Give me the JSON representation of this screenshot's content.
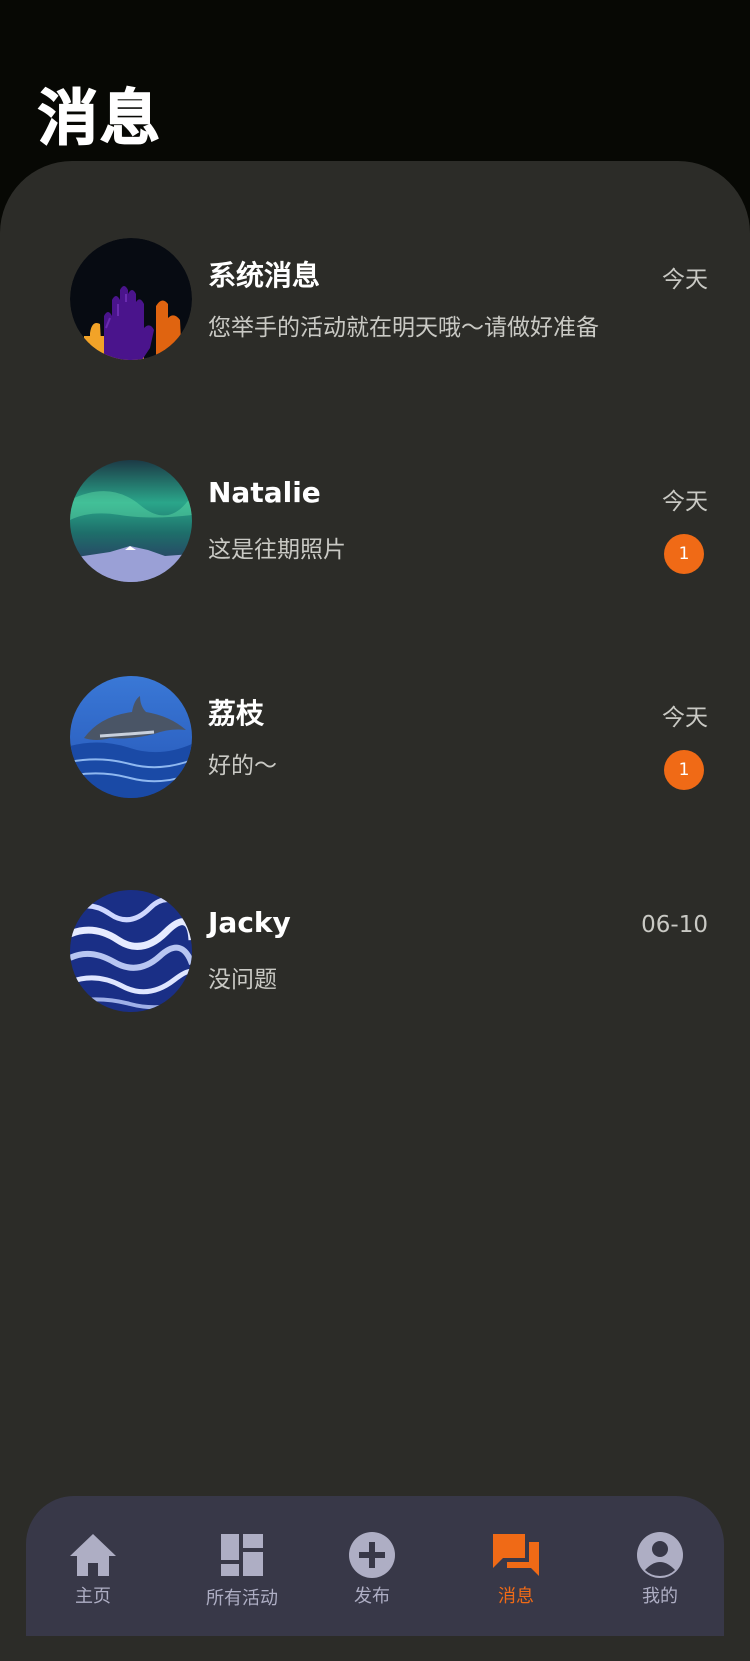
{
  "page": {
    "title": "消息"
  },
  "messages": [
    {
      "name": "系统消息",
      "preview": "您举手的活动就在明天哦～请做好准备",
      "date": "今天",
      "badge": "",
      "avatar": "raised-hands-avatar"
    },
    {
      "name": "Natalie",
      "preview": "这是往期照片",
      "date": "今天",
      "badge": "1",
      "avatar": "aurora-avatar"
    },
    {
      "name": "荔枝",
      "preview": "好的～",
      "date": "今天",
      "badge": "1",
      "avatar": "dolphin-avatar"
    },
    {
      "name": "Jacky",
      "preview": "没问题",
      "date": "06-10",
      "badge": "",
      "avatar": "ocean-waves-avatar"
    }
  ],
  "tabbar": {
    "tabs": [
      {
        "label": "主页",
        "icon": "home-icon"
      },
      {
        "label": "所有活动",
        "icon": "dashboard-icon"
      },
      {
        "label": "发布",
        "icon": "add-circle-icon"
      },
      {
        "label": "消息",
        "icon": "chat-icon",
        "active": true
      },
      {
        "label": "我的",
        "icon": "account-circle-icon"
      }
    ]
  },
  "colors": {
    "accent": "#f06a16",
    "panel": "#2c2c28",
    "background": "#070804",
    "tabbar": "#383848",
    "inactive_tab": "#aeaec4"
  }
}
